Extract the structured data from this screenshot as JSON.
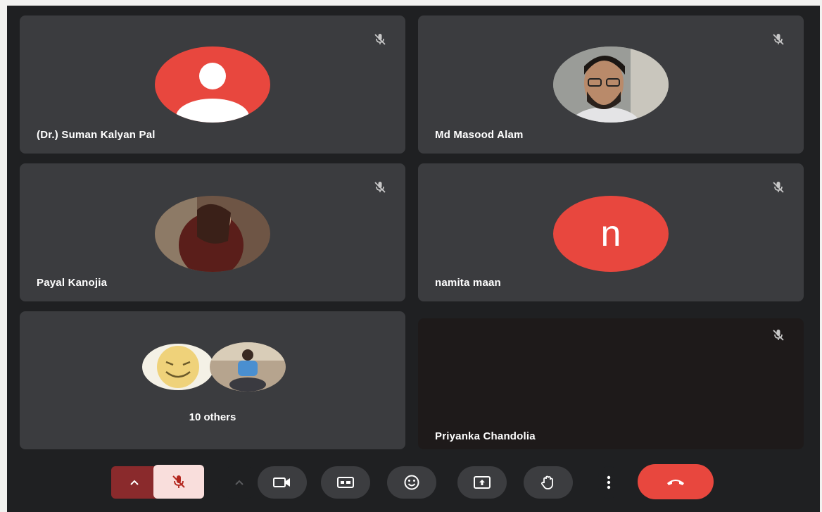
{
  "participants": [
    {
      "name": "(Dr.) Suman Kalyan Pal",
      "avatar": "default-person-icon",
      "muted": true
    },
    {
      "name": "Md Masood Alam",
      "avatar": "profile-photo",
      "muted": true
    },
    {
      "name": "Payal Kanojia",
      "avatar": "profile-photo",
      "muted": true
    },
    {
      "name": "namita maan",
      "avatar_letter": "n",
      "muted": true
    },
    {
      "name": "Priyanka Chandolia",
      "avatar": "none",
      "muted": true
    }
  ],
  "others": {
    "label": "10 others"
  },
  "toolbar": {
    "buttons": [
      "audio-options-chevron-icon",
      "mic-off-icon",
      "video-options-chevron-icon",
      "camera-icon",
      "captions-icon",
      "emoji-icon",
      "present-screen-icon",
      "raise-hand-icon",
      "more-options-icon",
      "end-call-icon"
    ]
  },
  "colors": {
    "accent_red": "#e8473e",
    "tile": "#3b3c3f",
    "mic_off_bg": "#f9dedc"
  }
}
